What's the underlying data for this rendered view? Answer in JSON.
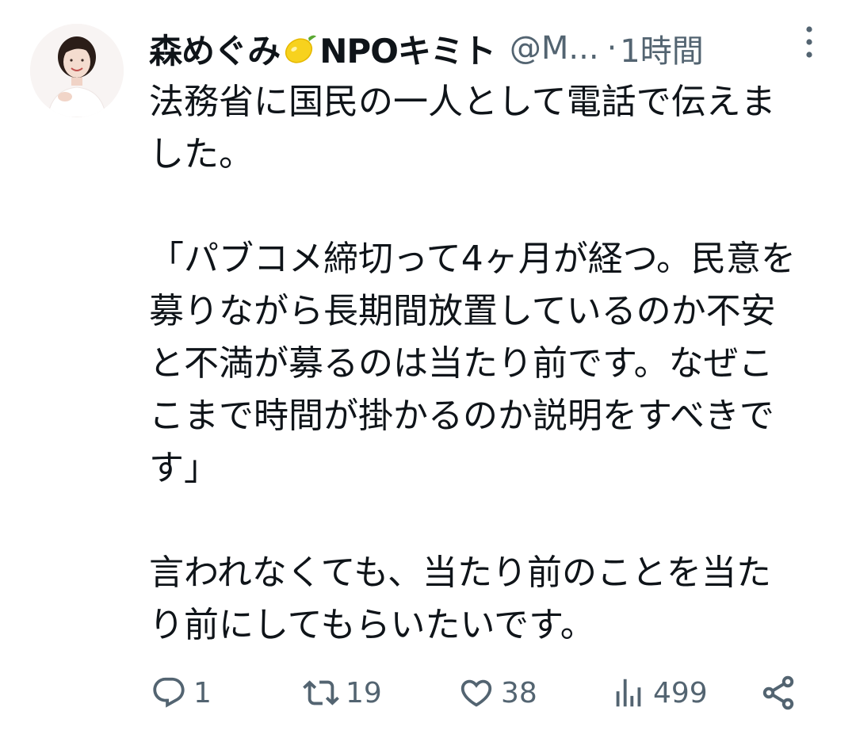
{
  "tweet": {
    "author": {
      "name": "森めぐみ",
      "emoji": "lemon-emoji",
      "org": "NPOキミト",
      "handle": "@M...",
      "separator": "·",
      "time": "1時間"
    },
    "paragraphs": [
      "法務省に国民の一人として電話で伝えま\nした。",
      "「パブコメ締切って4ヶ月が経つ。民意を\n募りながら長期間放置しているのか不安\nと不満が募るのは当たり前です。なぜこ\nこまで時間が掛かるのか説明をすべきで\nす」",
      "言われなくても、当たり前のことを当た\nり前にしてもらいたいです。"
    ],
    "actions": {
      "reply_count": "1",
      "retweet_count": "19",
      "like_count": "38",
      "views_count": "499"
    },
    "icons": {
      "reply": "reply-icon",
      "retweet": "retweet-icon",
      "like": "heart-icon",
      "views": "views-icon",
      "share": "share-icon",
      "more": "more-icon"
    },
    "colors": {
      "text": "#0f1419",
      "secondary": "#536471",
      "lemon": "#f7d21e"
    }
  }
}
